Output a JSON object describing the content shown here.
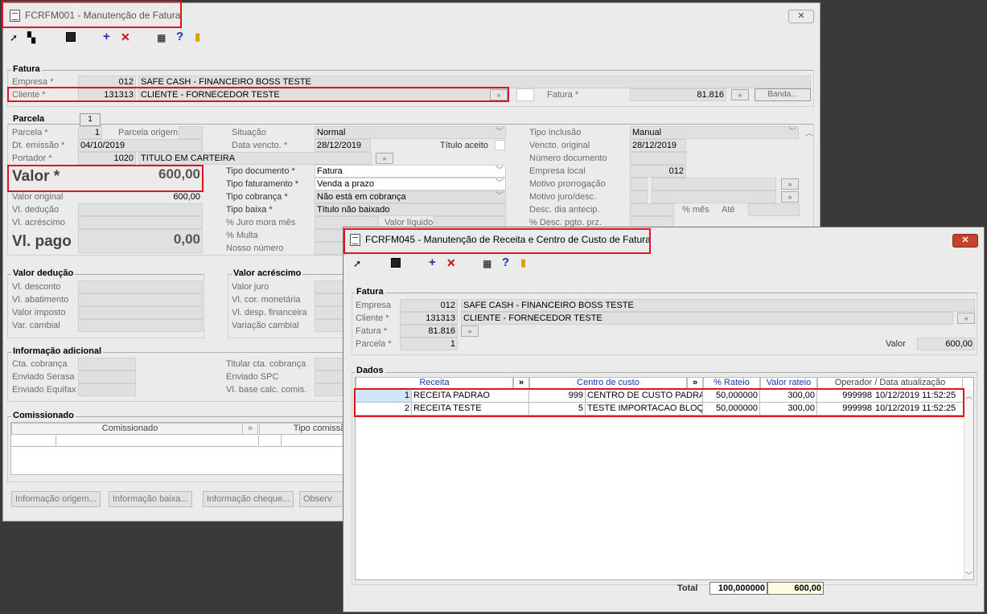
{
  "w1": {
    "title": "FCRFM001 - Manutenção de Fatura",
    "close": "✕",
    "fatura_group": "Fatura",
    "empresa_label": "Empresa *",
    "empresa_code": "012",
    "empresa_name": "SAFE CASH - FINANCEIRO BOSS TESTE",
    "cliente_label": "Cliente *",
    "cliente_code": "131313",
    "cliente_name": "CLIENTE - FORNECEDOR TESTE",
    "fatura_label": "Fatura *",
    "fatura_value": "81.816",
    "banda_btn": "Banda...",
    "parcela_group": "Parcela",
    "parcela_tab": "1",
    "parcela_label": "Parcela *",
    "parcela_value": "1",
    "parcela_origem_label": "Parcela origem",
    "dt_emissao_label": "Dt. emissão *",
    "dt_emissao_value": "04/10/2019",
    "portador_label": "Portador *",
    "portador_code": "1020",
    "portador_name": "TITULO EM CARTEIRA",
    "valor_label": "Valor *",
    "valor_value": "600,00",
    "valor_original_label": "Valor original",
    "valor_original_value": "600,00",
    "vl_deducao_label": "Vl. dedução",
    "vl_acrescimo_label": "Vl. acréscimo",
    "vl_pago_label": "Vl. pago",
    "vl_pago_value": "0,00",
    "situacao_label": "Situação",
    "situacao_value": "Normal",
    "data_vencto_label": "Data vencto. *",
    "data_vencto_value": "28/12/2019",
    "titulo_aceito_label": "Título aceito",
    "tipo_doc_label": "Tipo documento *",
    "tipo_doc_value": "Fatura",
    "tipo_fat_label": "Tipo faturamento *",
    "tipo_fat_value": "Venda a prazo",
    "tipo_cob_label": "Tipo cobrança *",
    "tipo_cob_value": "Não está em cobrança",
    "tipo_baixa_label": "Tipo baixa *",
    "tipo_baixa_value": "Título não baixado",
    "juro_label": "% Juro mora mês",
    "valor_liquido_label": "Valor líquido",
    "multa_label": "% Multa",
    "nosso_numero_label": "Nosso número",
    "tipo_inclusao_label": "Tipo inclusão",
    "tipo_inclusao_value": "Manual",
    "vencto_original_label": "Vencto. original",
    "vencto_original_value": "28/12/2019",
    "numero_doc_label": "Número documento",
    "empresa_local_label": "Empresa local",
    "empresa_local_value": "012",
    "motivo_prorrog_label": "Motivo prorrogação",
    "motivo_juro_label": "Motivo juro/desc.",
    "desc_dia_label": "Desc. dia antecip.",
    "pct_mes_label": "% mês",
    "ate_label": "Até",
    "desc_pgto_label": "% Desc. pgto. prz.",
    "valor_deducao_group": "Valor dedução",
    "vl_desconto_label": "Vl. desconto",
    "vl_abatimento_label": "Vl. abatimento",
    "valor_imposto_label": "Valor imposto",
    "var_cambial_label": "Var. cambial",
    "valor_acrescimo_group": "Valor acréscimo",
    "valor_juro_label": "Valor juro",
    "vl_cor_monetaria_label": "Vl. cor. monetária",
    "vl_desp_financeira_label": "Vl. desp. financeira",
    "variacao_cambial_label": "Variação cambial",
    "info_adicional_group": "Informação adicional",
    "cta_cobranca_label": "Cta. cobrança",
    "enviado_serasa_label": "Enviado Serasa",
    "enviado_equifax_label": "Enviado Equifax",
    "titular_cta_label": "Titular cta. cobrança",
    "enviado_spc_label": "Enviado SPC",
    "vl_base_calc_label": "Vl. base calc. comis.",
    "comissionado_group": "Comissionado",
    "comissionado_col": "Comissionado",
    "tipo_comissao_col": "Tipo comissã",
    "btn_info_origem": "Informação origem...",
    "btn_info_baixa": "Informação baixa...",
    "btn_info_cheque": "Informação cheque...",
    "btn_observ": "Observ"
  },
  "w2": {
    "title": "FCRFM045 - Manutenção de Receita e Centro de Custo de Fatura",
    "close": "✕",
    "fatura_group": "Fatura",
    "empresa_label": "Empresa",
    "empresa_code": "012",
    "empresa_name": "SAFE CASH - FINANCEIRO BOSS TESTE",
    "cliente_label": "Cliente *",
    "cliente_code": "131313",
    "cliente_name": "CLIENTE - FORNECEDOR TESTE",
    "fatura_label": "Fatura *",
    "fatura_value": "81.816",
    "parcela_label": "Parcela *",
    "parcela_value": "1",
    "valor_label": "Valor",
    "valor_value": "600,00",
    "dados_group": "Dados",
    "columns": [
      "Receita",
      "»",
      "Centro de custo",
      "»",
      "% Rateio",
      "Valor rateio",
      "Operador / Data atualização"
    ],
    "rows": [
      [
        "1",
        "RECEITA PADRAO",
        "999",
        "CENTRO DE CUSTO PADRAO",
        "50,000000",
        "300,00",
        "999998",
        "10/12/2019 11:52:25"
      ],
      [
        "2",
        "RECEITA TESTE",
        "5",
        "TESTE IMPORTACAO BLOQ",
        "50,000000",
        "300,00",
        "999998",
        "10/12/2019 11:52:25"
      ]
    ],
    "total_label": "Total",
    "total_rateio": "100,000000",
    "total_valor": "600,00"
  },
  "colors": {
    "highlight": "#e0141e",
    "row_selected": "#cfe6f7"
  }
}
